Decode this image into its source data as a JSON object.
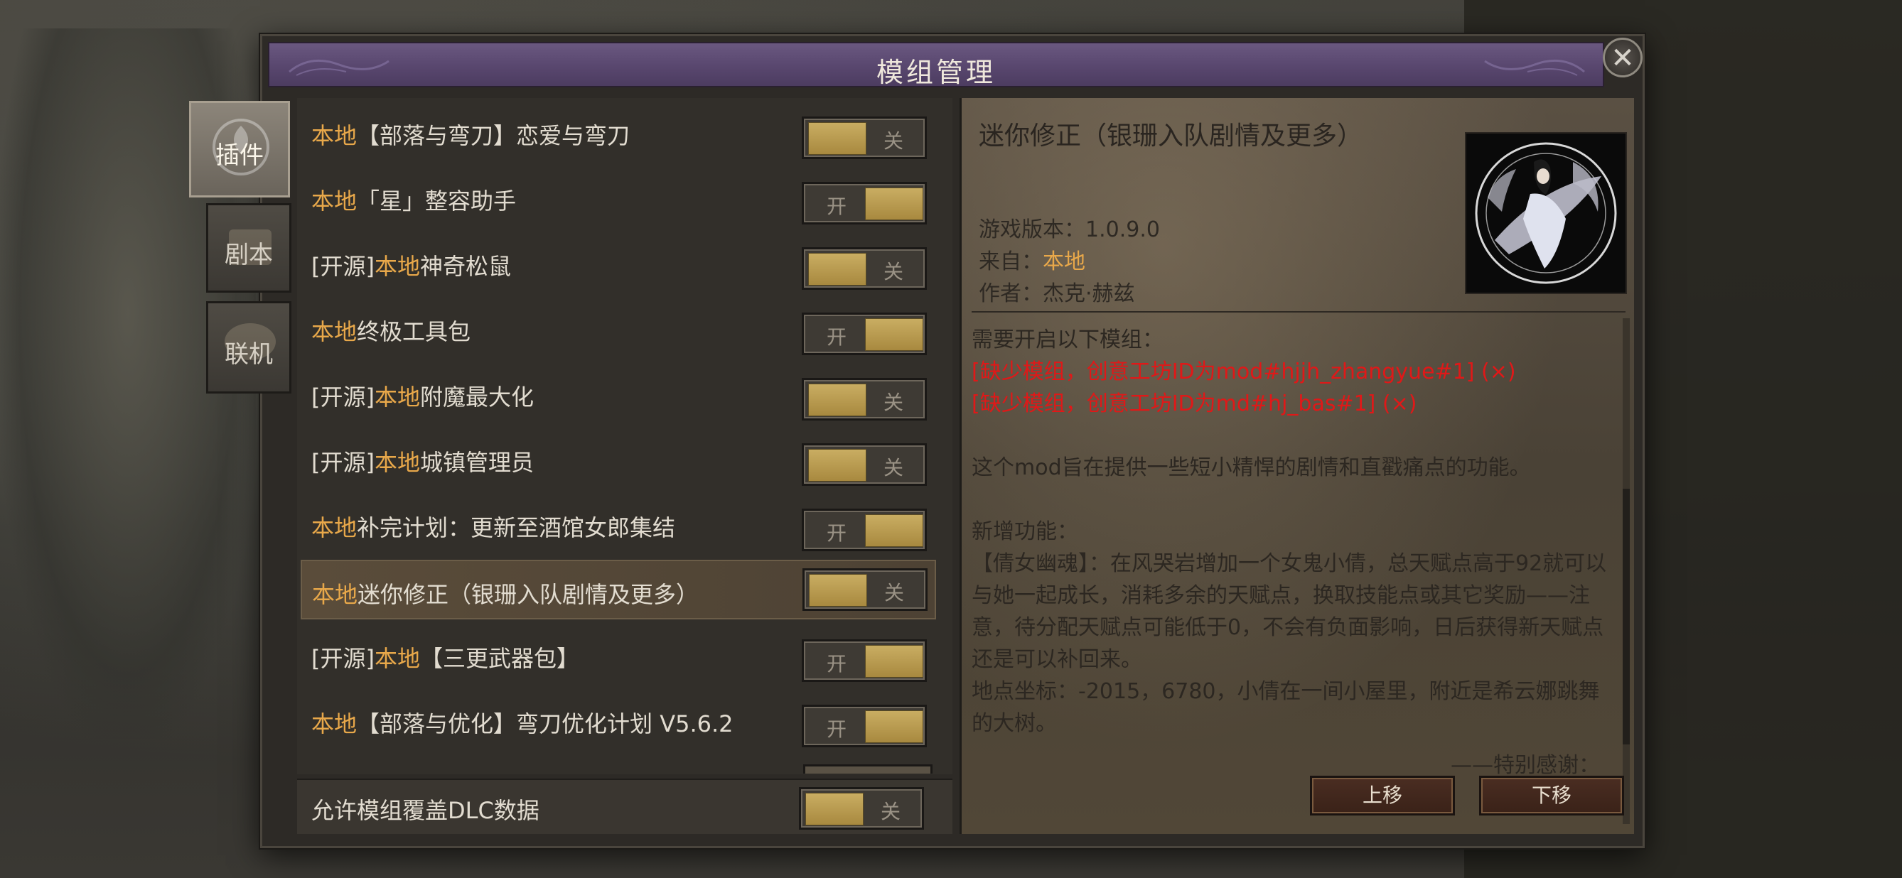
{
  "window": {
    "title": "模组管理",
    "close_glyph": "✕"
  },
  "tabs": [
    {
      "label": "插件",
      "active": true
    },
    {
      "label": "剧本",
      "active": false
    },
    {
      "label": "联机",
      "active": false
    }
  ],
  "mods": [
    {
      "prefix": "",
      "highlight": "本地",
      "suffix": "【部落与弯刀】恋爱与弯刀",
      "toggle": "关",
      "on": false
    },
    {
      "prefix": "",
      "highlight": "本地",
      "suffix": "「星」整容助手",
      "toggle": "开",
      "on": true
    },
    {
      "prefix": "[开源]",
      "highlight": "本地",
      "suffix": "神奇松鼠",
      "toggle": "关",
      "on": false
    },
    {
      "prefix": "",
      "highlight": "本地",
      "suffix": "终极工具包",
      "toggle": "开",
      "on": true
    },
    {
      "prefix": "[开源]",
      "highlight": "本地",
      "suffix": "附魔最大化",
      "toggle": "关",
      "on": false
    },
    {
      "prefix": "[开源]",
      "highlight": "本地",
      "suffix": "城镇管理员",
      "toggle": "关",
      "on": false
    },
    {
      "prefix": "",
      "highlight": "本地",
      "suffix": "补完计划：更新至酒馆女郎集结",
      "toggle": "开",
      "on": true
    },
    {
      "prefix": "",
      "highlight": "本地",
      "suffix": "迷你修正（银珊入队剧情及更多）",
      "toggle": "关",
      "on": false,
      "selected": true
    },
    {
      "prefix": "[开源]",
      "highlight": "本地",
      "suffix": "【三更武器包】",
      "toggle": "开",
      "on": true
    },
    {
      "prefix": "",
      "highlight": "本地",
      "suffix": "【部落与优化】弯刀优化计划 V5.6.2",
      "toggle": "开",
      "on": true
    }
  ],
  "dlc": {
    "label": "允许模组覆盖DLC数据",
    "toggle": "关"
  },
  "detail": {
    "title": "迷你修正（银珊入队剧情及更多）",
    "version_label": "游戏版本：1.0.9.0",
    "source_label": "来自：",
    "source_value": "本地",
    "author_label": "作者：杰克·赫兹",
    "requires_heading": "需要开启以下模组：",
    "missing": [
      "[缺少模组，创意工坊ID为mod#hjjh_zhangyue#1] (×)",
      "[缺少模组，创意工坊ID为md#hj_bas#1] (×)"
    ],
    "intro": "这个mod旨在提供一些短小精悍的剧情和直戳痛点的功能。",
    "features_heading": "新增功能：",
    "feature_text": "【倩女幽魂】：在风哭岩增加一个女鬼小倩，总天赋点高于92就可以与她一起成长，消耗多余的天赋点，换取技能点或其它奖励——注意，待分配天赋点可能低于0，不会有负面影响，日后获得新天赋点还是可以补回来。",
    "location_text": "地点坐标：-2015，6780，小倩在一间小屋里，附近是希云娜跳舞的大树。",
    "thanks": "——特别感谢：",
    "avatar_icon": "mod-avatar-portrait"
  },
  "buttons": {
    "up": "上移",
    "down": "下移"
  },
  "colors": {
    "highlight": "#e8a84a",
    "error": "#e01818",
    "title_bar": "#5a4870"
  }
}
